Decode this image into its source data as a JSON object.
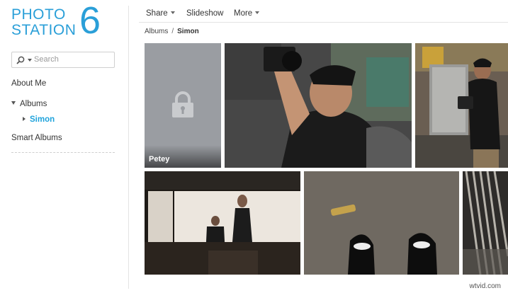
{
  "logo": {
    "line1": "PHOTO",
    "line2": "STATION",
    "number": "6"
  },
  "search": {
    "placeholder": "Search"
  },
  "sidebar": {
    "about": "About Me",
    "albums": "Albums",
    "simon": "Simon",
    "smart_albums": "Smart Albums"
  },
  "toolbar": {
    "share": "Share",
    "slideshow": "Slideshow",
    "more": "More"
  },
  "breadcrumb": {
    "root": "Albums",
    "separator": "/",
    "current": "Simon"
  },
  "tiles": {
    "locked_album": "Petey"
  },
  "watermark": "wtvid.com",
  "colors": {
    "accent": "#1fa3dc",
    "logo": "#2a9fd8"
  }
}
